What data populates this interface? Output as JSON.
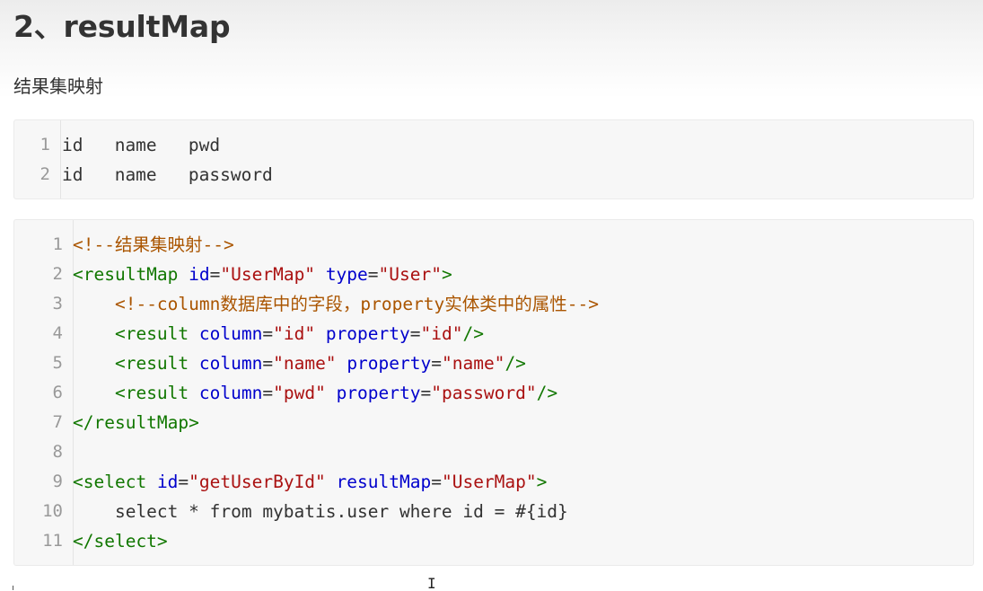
{
  "heading": "2、resultMap",
  "paragraph": "结果集映射",
  "block1": {
    "line_numbers": [
      "1",
      "2"
    ],
    "lines": [
      [
        {
          "t": "id   name   pwd",
          "c": "plain"
        }
      ],
      [
        {
          "t": "id   name   password",
          "c": "plain"
        }
      ]
    ]
  },
  "block2": {
    "line_numbers": [
      "1",
      "2",
      "3",
      "4",
      "5",
      "6",
      "7",
      "8",
      "9",
      "10",
      "11"
    ],
    "lines": [
      [
        {
          "t": "<!--结果集映射-->",
          "c": "comment"
        }
      ],
      [
        {
          "t": "<resultMap",
          "c": "tag"
        },
        {
          "t": " ",
          "c": "plain"
        },
        {
          "t": "id",
          "c": "attr"
        },
        {
          "t": "=",
          "c": "plain"
        },
        {
          "t": "\"UserMap\"",
          "c": "str"
        },
        {
          "t": " ",
          "c": "plain"
        },
        {
          "t": "type",
          "c": "attr"
        },
        {
          "t": "=",
          "c": "plain"
        },
        {
          "t": "\"User\"",
          "c": "str"
        },
        {
          "t": ">",
          "c": "tag"
        }
      ],
      [
        {
          "t": "    ",
          "c": "plain"
        },
        {
          "t": "<!--column数据库中的字段，property实体类中的属性-->",
          "c": "comment"
        }
      ],
      [
        {
          "t": "    ",
          "c": "plain"
        },
        {
          "t": "<result",
          "c": "tag"
        },
        {
          "t": " ",
          "c": "plain"
        },
        {
          "t": "column",
          "c": "attr"
        },
        {
          "t": "=",
          "c": "plain"
        },
        {
          "t": "\"id\"",
          "c": "str"
        },
        {
          "t": " ",
          "c": "plain"
        },
        {
          "t": "property",
          "c": "attr"
        },
        {
          "t": "=",
          "c": "plain"
        },
        {
          "t": "\"id\"",
          "c": "str"
        },
        {
          "t": "/>",
          "c": "tag"
        }
      ],
      [
        {
          "t": "    ",
          "c": "plain"
        },
        {
          "t": "<result",
          "c": "tag"
        },
        {
          "t": " ",
          "c": "plain"
        },
        {
          "t": "column",
          "c": "attr"
        },
        {
          "t": "=",
          "c": "plain"
        },
        {
          "t": "\"name\"",
          "c": "str"
        },
        {
          "t": " ",
          "c": "plain"
        },
        {
          "t": "property",
          "c": "attr"
        },
        {
          "t": "=",
          "c": "plain"
        },
        {
          "t": "\"name\"",
          "c": "str"
        },
        {
          "t": "/>",
          "c": "tag"
        }
      ],
      [
        {
          "t": "    ",
          "c": "plain"
        },
        {
          "t": "<result",
          "c": "tag"
        },
        {
          "t": " ",
          "c": "plain"
        },
        {
          "t": "column",
          "c": "attr"
        },
        {
          "t": "=",
          "c": "plain"
        },
        {
          "t": "\"pwd\"",
          "c": "str"
        },
        {
          "t": " ",
          "c": "plain"
        },
        {
          "t": "property",
          "c": "attr"
        },
        {
          "t": "=",
          "c": "plain"
        },
        {
          "t": "\"password\"",
          "c": "str"
        },
        {
          "t": "/>",
          "c": "tag"
        }
      ],
      [
        {
          "t": "</resultMap>",
          "c": "tag"
        }
      ],
      [],
      [
        {
          "t": "<select",
          "c": "tag"
        },
        {
          "t": " ",
          "c": "plain"
        },
        {
          "t": "id",
          "c": "attr"
        },
        {
          "t": "=",
          "c": "plain"
        },
        {
          "t": "\"getUserById\"",
          "c": "str"
        },
        {
          "t": " ",
          "c": "plain"
        },
        {
          "t": "resultMap",
          "c": "attr"
        },
        {
          "t": "=",
          "c": "plain"
        },
        {
          "t": "\"UserMap\"",
          "c": "str"
        },
        {
          "t": ">",
          "c": "tag"
        }
      ],
      [
        {
          "t": "    select * from mybatis.user where id = #{id}",
          "c": "plain"
        }
      ],
      [
        {
          "t": "</select>",
          "c": "tag"
        }
      ]
    ]
  },
  "colors": {
    "comment": "#aa5500",
    "tag": "#117700",
    "attr": "#0000cc",
    "str": "#aa1111",
    "plain": "#333333",
    "line_number": "#999999",
    "code_background": "#f7f7f7"
  },
  "cursor_icon": "text-cursor-icon"
}
